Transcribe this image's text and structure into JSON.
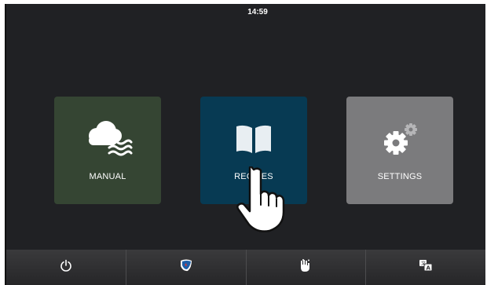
{
  "status_bar": {
    "time": "14:59"
  },
  "tiles": [
    {
      "label": "MANUAL",
      "icon": "cloud-steam-icon",
      "color": "#354533"
    },
    {
      "label": "RECIPES",
      "icon": "book-icon",
      "color": "#073a53"
    },
    {
      "label": "SETTINGS",
      "icon": "gears-icon",
      "color": "#7b7b7d"
    }
  ],
  "bottom_bar": {
    "buttons": [
      {
        "icon": "power-icon"
      },
      {
        "icon": "cleaning-icon"
      },
      {
        "icon": "hand-wash-icon"
      },
      {
        "icon": "language-icon"
      }
    ]
  },
  "overlay": {
    "icon": "pointer-hand-icon"
  }
}
